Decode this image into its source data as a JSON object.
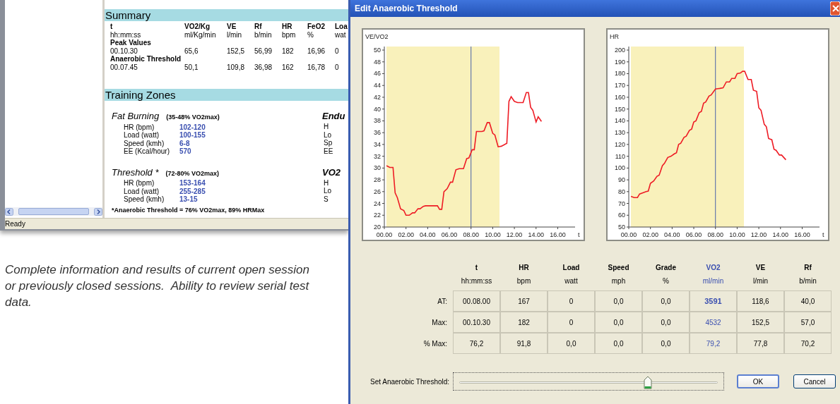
{
  "report_window": {
    "summary": {
      "title": "Summary",
      "columns": [
        {
          "label": "t",
          "unit": "hh:mm:ss"
        },
        {
          "label": "VO2/Kg",
          "unit": "ml/Kg/min"
        },
        {
          "label": "VE",
          "unit": "l/min"
        },
        {
          "label": "Rf",
          "unit": "b/min"
        },
        {
          "label": "HR",
          "unit": "bpm"
        },
        {
          "label": "FeO2",
          "unit": "%"
        },
        {
          "label": "Loa",
          "unit": "wat"
        }
      ],
      "groups": [
        {
          "label": "Peak Values",
          "values": [
            "00.10.30",
            "65,6",
            "152,5",
            "56,99",
            "182",
            "16,96",
            "0"
          ]
        },
        {
          "label": "Anaerobic Threshold",
          "values": [
            "00.07.45",
            "50,1",
            "109,8",
            "36,98",
            "162",
            "16,78",
            "0"
          ]
        }
      ]
    },
    "training_zones": {
      "title": "Training Zones",
      "zones": [
        {
          "name": "Fat Burning",
          "range": "(35-48% VO2max)",
          "rows": [
            {
              "label": "HR (bpm)",
              "value": "102-120"
            },
            {
              "label": "Load (watt)",
              "value": "100-155"
            },
            {
              "label": "Speed (kmh)",
              "value": "6-8"
            },
            {
              "label": "EE (Kcal/hour)",
              "value": "570"
            }
          ]
        },
        {
          "name": "Threshold *",
          "range": "(72-80% VO2max)",
          "rows": [
            {
              "label": "HR (bpm)",
              "value": "153-164"
            },
            {
              "label": "Load (watt)",
              "value": "255-285"
            },
            {
              "label": "Speed (kmh)",
              "value": "13-15"
            }
          ]
        }
      ],
      "cut_zones": [
        {
          "name": "Endu",
          "rows": [
            "H",
            "Lo",
            "Sp",
            "EE"
          ]
        },
        {
          "name": "VO2",
          "rows": [
            "H",
            "Lo",
            "S"
          ]
        }
      ],
      "footnote": "*Anaerobic Threshold = 76% VO2max, 89% HRMax"
    },
    "status_bar": "Ready"
  },
  "caption": "Complete information and results of current open session or previously closed sessions.  Ability to review serial test data.",
  "dialog": {
    "title": "Edit Anaerobic Threshold",
    "charts": [
      {
        "chart_data": {
          "type": "line",
          "ylabel": "VE/VO2",
          "xlabel": "t",
          "xlim": [
            0,
            17.6
          ],
          "ylim": [
            20,
            50.6
          ],
          "xticks": [
            {
              "value": 0,
              "label": "00.00"
            },
            {
              "value": 2,
              "label": "02.00"
            },
            {
              "value": 4,
              "label": "04.00"
            },
            {
              "value": 6,
              "label": "06.00"
            },
            {
              "value": 8,
              "label": "08.00"
            },
            {
              "value": 10,
              "label": "10.00"
            },
            {
              "value": 12,
              "label": "12.00"
            },
            {
              "value": 14,
              "label": "14.00"
            },
            {
              "value": 16,
              "label": "16.00"
            }
          ],
          "yticks": [
            20,
            22,
            24,
            26,
            28,
            30,
            32,
            34,
            36,
            38,
            40,
            42,
            44,
            46,
            48,
            50
          ],
          "x": [
            0.2,
            0.5,
            0.8,
            1.0,
            1.2,
            1.5,
            1.8,
            2.0,
            2.3,
            2.6,
            2.8,
            3.1,
            3.3,
            3.6,
            3.8,
            4.2,
            4.9,
            5.1,
            5.3,
            5.5,
            5.8,
            6.1,
            6.3,
            6.6,
            6.9,
            7.3,
            7.6,
            7.8,
            8.1,
            8.3,
            8.5,
            9.0,
            9.2,
            9.5,
            9.7,
            10.0,
            10.2,
            10.5,
            10.8,
            11.3,
            11.5,
            11.7,
            12.0,
            12.3,
            12.8,
            13.1,
            13.3,
            13.5,
            13.7,
            14.0,
            14.2,
            14.5
          ],
          "series": [
            {
              "color": "#ee1c25",
              "values": [
                30.4,
                30.1,
                30.1,
                25.8,
                25,
                23.1,
                22.8,
                22,
                22,
                22.4,
                22.4,
                23.1,
                23.1,
                23.5,
                23.6,
                23.6,
                23.6,
                23,
                23,
                26,
                26.5,
                27.6,
                27.6,
                29.7,
                29.9,
                29.9,
                31.6,
                31.7,
                33.1,
                33.1,
                36.2,
                36.2,
                36.3,
                37.7,
                37.7,
                35.9,
                35.6,
                33.6,
                33.7,
                34.2,
                41.3,
                42.1,
                41.3,
                41.1,
                41.1,
                42.8,
                42.8,
                40.3,
                39.8,
                37.8,
                38.7,
                37.9
              ]
            }
          ],
          "ref_lines": [
            {
              "axis": "x",
              "value": 8
            }
          ]
        }
      },
      {
        "chart_data": {
          "type": "line",
          "ylabel": "HR",
          "xlabel": "t",
          "xlim": [
            0,
            17.6
          ],
          "ylim": [
            50,
            203
          ],
          "xticks": [
            {
              "value": 0,
              "label": "00.00"
            },
            {
              "value": 2,
              "label": "02.00"
            },
            {
              "value": 4,
              "label": "04.00"
            },
            {
              "value": 6,
              "label": "06.00"
            },
            {
              "value": 8,
              "label": "08.00"
            },
            {
              "value": 10,
              "label": "10.00"
            },
            {
              "value": 12,
              "label": "12.00"
            },
            {
              "value": 14,
              "label": "14.00"
            },
            {
              "value": 16,
              "label": "16.00"
            }
          ],
          "yticks": [
            50,
            60,
            70,
            80,
            90,
            100,
            110,
            120,
            130,
            140,
            150,
            160,
            170,
            180,
            190,
            200
          ],
          "x": [
            0.2,
            0.5,
            0.8,
            1.0,
            1.3,
            1.6,
            1.8,
            2.0,
            2.3,
            2.6,
            2.8,
            3.1,
            3.3,
            3.6,
            3.9,
            4.2,
            4.4,
            4.6,
            4.8,
            5.1,
            5.3,
            5.6,
            5.8,
            6.0,
            6.2,
            6.5,
            6.7,
            6.9,
            7.1,
            7.4,
            7.6,
            8.0,
            8.4,
            8.7,
            9.0,
            9.3,
            9.5,
            9.8,
            10.0,
            10.3,
            10.5,
            10.7,
            11.0,
            11.3,
            11.5,
            11.8,
            12.0,
            12.2,
            12.5,
            12.7,
            12.9,
            13.2,
            13.4,
            13.6,
            13.9,
            14.1,
            14.5
          ],
          "series": [
            {
              "color": "#ee1c25",
              "values": [
                76,
                75,
                75,
                78,
                79,
                80,
                80.5,
                87,
                89,
                93,
                94,
                102,
                104,
                109,
                110,
                112,
                113,
                120,
                121,
                126,
                127,
                132,
                133,
                139,
                140,
                147,
                148,
                155,
                156,
                161,
                162,
                167,
                167.5,
                168,
                173,
                173,
                176,
                176,
                180,
                180.5,
                182,
                182,
                175,
                175,
                166,
                165,
                151,
                149,
                137,
                135,
                125,
                124,
                116,
                115,
                111,
                111,
                107
              ]
            }
          ],
          "ref_lines": [
            {
              "axis": "x",
              "value": 8
            }
          ]
        }
      }
    ],
    "table": {
      "columns": [
        {
          "label": "t",
          "unit": "hh:mm:ss",
          "selected": false
        },
        {
          "label": "HR",
          "unit": "bpm",
          "selected": false
        },
        {
          "label": "Load",
          "unit": "watt",
          "selected": false
        },
        {
          "label": "Speed",
          "unit": "mph",
          "selected": false
        },
        {
          "label": "Grade",
          "unit": "%",
          "selected": false
        },
        {
          "label": "VO2",
          "unit": "ml/min",
          "selected": true
        },
        {
          "label": "VE",
          "unit": "l/min",
          "selected": false
        },
        {
          "label": "Rf",
          "unit": "b/min",
          "selected": false
        }
      ],
      "rows": [
        {
          "label": "AT:",
          "highlight": true,
          "cells": [
            "00.08.00",
            "167",
            "0",
            "0,0",
            "0,0",
            "3591",
            "118,6",
            "40,0"
          ]
        },
        {
          "label": "Max:",
          "highlight": false,
          "cells": [
            "00.10.30",
            "182",
            "0",
            "0,0",
            "0,0",
            "4532",
            "152,5",
            "57,0"
          ]
        },
        {
          "label": "% Max:",
          "highlight": false,
          "cells": [
            "76,2",
            "91,8",
            "0,0",
            "0,0",
            "0,0",
            "79,2",
            "77,8",
            "70,2"
          ]
        }
      ]
    },
    "slider": {
      "label": "Set Anaerobic Threshold:",
      "level": 0.73
    },
    "buttons": [
      {
        "label": "OK",
        "kind": "default"
      },
      {
        "label": "Cancel",
        "kind": "normal"
      }
    ]
  }
}
